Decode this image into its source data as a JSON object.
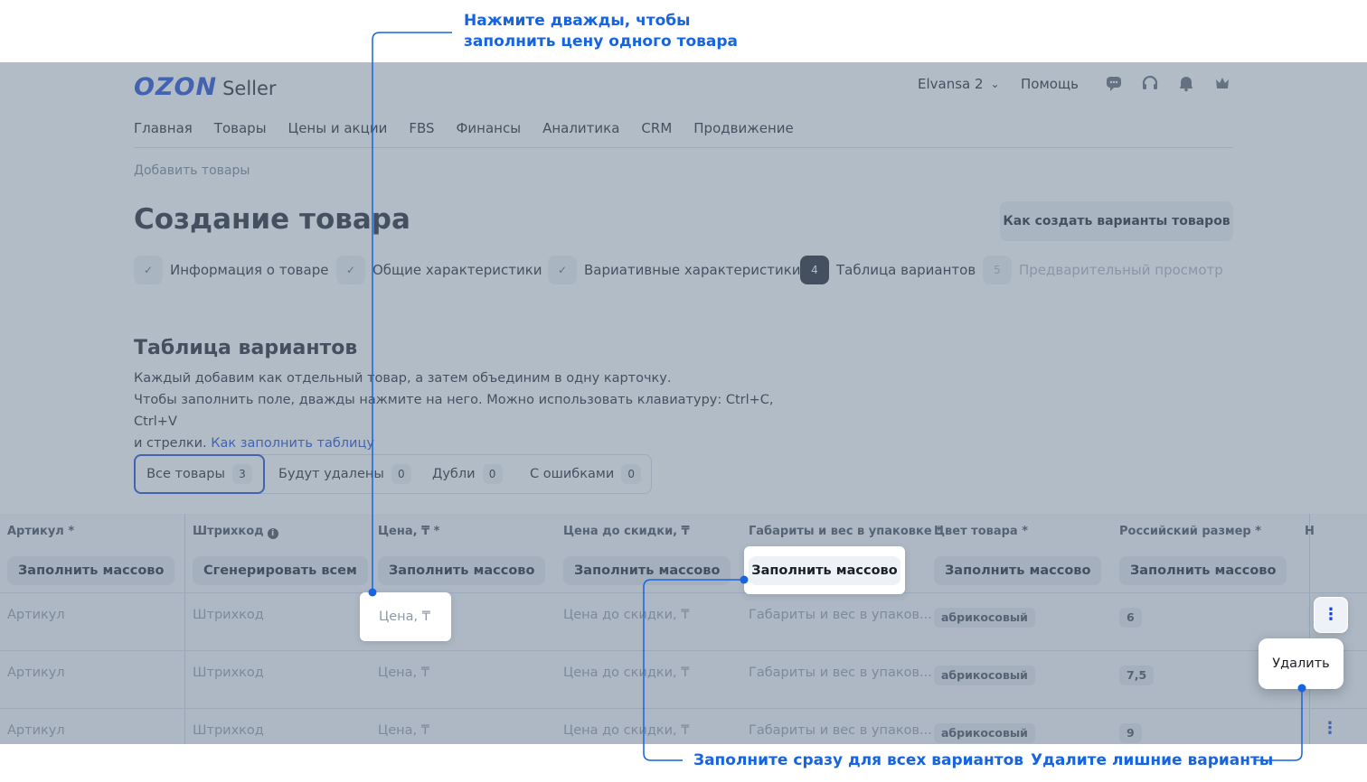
{
  "header": {
    "logo_brand": "OZON",
    "logo_product": "Seller",
    "account": "Elvansa 2",
    "help": "Помощь",
    "icons": [
      "chat-icon",
      "headset-icon",
      "bell-icon",
      "crown-icon"
    ]
  },
  "nav": [
    "Главная",
    "Товары",
    "Цены и акции",
    "FBS",
    "Финансы",
    "Аналитика",
    "CRM",
    "Продвижение"
  ],
  "breadcrumb": "Добавить товары",
  "page": {
    "title": "Создание товара",
    "howto_button": "Как создать варианты товаров"
  },
  "steps": [
    {
      "badge": "✓",
      "label": "Информация о товаре",
      "state": "done"
    },
    {
      "badge": "✓",
      "label": "Общие характеристики",
      "state": "done"
    },
    {
      "badge": "✓",
      "label": "Вариативные характеристики",
      "state": "done"
    },
    {
      "badge": "4",
      "label": "Таблица вариантов",
      "state": "active"
    },
    {
      "badge": "5",
      "label": "Предварительный просмотр",
      "state": "future"
    }
  ],
  "section": {
    "title": "Таблица вариантов",
    "line1": "Каждый добавим как отдельный товар, а затем объединим в одну карточку.",
    "line2": "Чтобы заполнить поле, дважды нажмите на него. Можно использовать клавиатуру: Ctrl+C, Ctrl+V",
    "line3": "и стрелки.",
    "link": "Как заполнить таблицу"
  },
  "filters": [
    {
      "label": "Все товары",
      "count": "3"
    },
    {
      "label": "Будут удалены",
      "count": "0"
    },
    {
      "label": "Дубли",
      "count": "0"
    },
    {
      "label": "С ошибками",
      "count": "0"
    }
  ],
  "table": {
    "columns": [
      "Артикул *",
      "Штрихкод",
      "Цена, ₸ *",
      "Цена до скидки, ₸",
      "Габариты и вес в упаковке *",
      "Цвет товара *",
      "Российский размер *",
      "Н"
    ],
    "mass_buttons": [
      "Заполнить массово",
      "Сгенерировать всем",
      "Заполнить массово",
      "Заполнить массово",
      "Заполнить массово",
      "Заполнить массово",
      "Заполнить массово"
    ],
    "placeholders": {
      "article": "Артикул",
      "barcode": "Штрихкод",
      "price": "Цена, ₸",
      "old_price": "Цена до скидки, ₸",
      "dims": "Габариты и вес в упаков..."
    },
    "rows": [
      {
        "color": "абрикосовый",
        "size": "6"
      },
      {
        "color": "абрикосовый",
        "size": "7,5"
      },
      {
        "color": "абрикосовый",
        "size": "9"
      }
    ],
    "row_menu_icon": "⋮",
    "delete_label": "Удалить"
  },
  "callouts": {
    "top": "Нажмите дважды, чтобы\nзаполнить цену одного товара",
    "top_line1": "Нажмите дважды, чтобы",
    "top_line2": "заполнить цену одного товара",
    "bottom_mass": "Заполните сразу для всех вариантов",
    "bottom_delete": "Удалите лишние варианты"
  },
  "colors": {
    "accent": "#1846d2",
    "callout": "#1764e0",
    "dim_overlay": "#6c7e94"
  }
}
